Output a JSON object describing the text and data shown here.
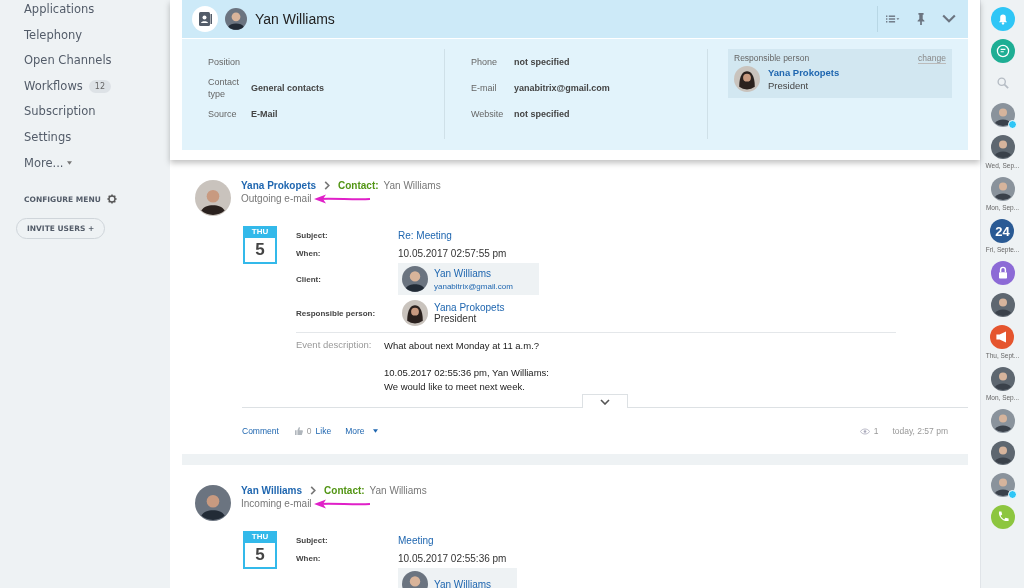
{
  "sidebar": {
    "items": [
      {
        "label": "Applications"
      },
      {
        "label": "Telephony"
      },
      {
        "label": "Open Channels"
      },
      {
        "label": "Workflows",
        "count": "12"
      },
      {
        "label": "Subscription"
      },
      {
        "label": "Settings"
      },
      {
        "label": "More...",
        "dropdown": true
      }
    ],
    "configure": "CONFIGURE MENU",
    "invite": "INVITE USERS",
    "invite_icon": "+"
  },
  "contact": {
    "name": "Yan Williams",
    "left": [
      {
        "label": "Position"
      },
      {
        "label": "Contact type",
        "value": "General contacts"
      },
      {
        "label": "Source",
        "value": "E-Mail"
      }
    ],
    "middle": [
      {
        "label": "Phone",
        "value": "not specified"
      },
      {
        "label": "E-mail",
        "value": "yanabitrix@gmail.com"
      },
      {
        "label": "Website",
        "value": "not specified"
      }
    ],
    "responsible": {
      "label": "Responsible person",
      "change": "change",
      "name": "Yana Prokopets",
      "role": "President"
    }
  },
  "feed": [
    {
      "author": "Yana Prokopets",
      "contact_label": "Contact:",
      "contact_name": "Yan Williams",
      "type": "Outgoing e-mail",
      "weekday": "THU",
      "day": "5",
      "subject_label": "Subject:",
      "subject": "Re: Meeting",
      "when_label": "When:",
      "when": "10.05.2017 02:57:55 pm",
      "client_label": "Client:",
      "client_name": "Yan Williams",
      "client_email": "yanabitrix@gmail.com",
      "resp_label": "Responsible person:",
      "resp_name": "Yana Prokopets",
      "resp_role": "President",
      "desc_label": "Event description:",
      "desc_lines": [
        "What about next Monday at 11 a.m.?",
        "10.05.2017 02:55:36 pm, Yan Williams:",
        "We would like to meet next week."
      ],
      "footer": {
        "comment": "Comment",
        "likes": "0",
        "like": "Like",
        "more": "More",
        "views": "1",
        "time": "today, 2:57 pm"
      }
    },
    {
      "author": "Yan Williams",
      "contact_label": "Contact:",
      "contact_name": "Yan Williams",
      "type": "Incoming e-mail",
      "weekday": "THU",
      "day": "5",
      "subject_label": "Subject:",
      "subject": "Meeting",
      "when_label": "When:",
      "when": "10.05.2017 02:55:36 pm",
      "client_name": "Yan Williams"
    }
  ],
  "rightbar": [
    {
      "kind": "bell"
    },
    {
      "kind": "chat"
    },
    {
      "kind": "search"
    },
    {
      "kind": "avatar",
      "online": true
    },
    {
      "kind": "avatar",
      "caption": "Wed, Sep..."
    },
    {
      "kind": "avatar",
      "caption": "Mon, Sep..."
    },
    {
      "kind": "number",
      "text": "24",
      "caption": "Fri, Septe..."
    },
    {
      "kind": "lock"
    },
    {
      "kind": "avatar"
    },
    {
      "kind": "megaphone",
      "caption": "Thu, Sept..."
    },
    {
      "kind": "avatar",
      "caption": "Mon, Sep..."
    },
    {
      "kind": "avatar"
    },
    {
      "kind": "avatar"
    },
    {
      "kind": "avatar",
      "online": true
    },
    {
      "kind": "phone"
    }
  ]
}
